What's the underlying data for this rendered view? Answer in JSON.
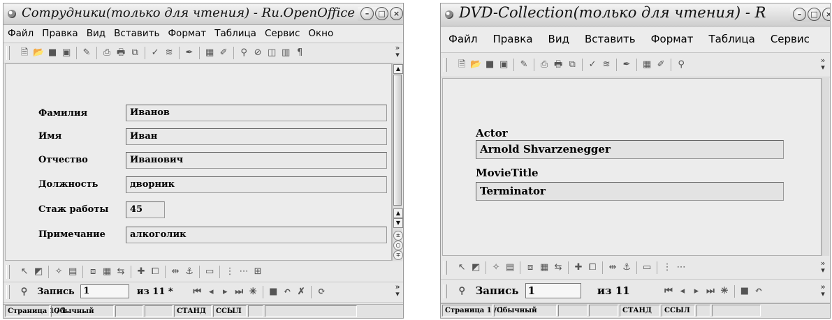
{
  "left_window": {
    "title": "Сотрудники(только для чтения) - Ru.OpenOffice",
    "menu": [
      "Файл",
      "Правка",
      "Вид",
      "Вставить",
      "Формат",
      "Таблица",
      "Сервис",
      "Окно"
    ],
    "fields": [
      {
        "label": "Фамилия",
        "value": "Иванов"
      },
      {
        "label": "Имя",
        "value": "Иван"
      },
      {
        "label": "Отчество",
        "value": "Иванович"
      },
      {
        "label": "Должность",
        "value": "дворник"
      },
      {
        "label": "Стаж работы",
        "value": "45"
      },
      {
        "label": "Примечание",
        "value": "алкоголик"
      }
    ],
    "nav": {
      "record_label": "Запись",
      "record_value": "1",
      "of_text": "из 11 *"
    },
    "status": {
      "page": "Страница 1 / 1",
      "style": "Обычный",
      "mode": "СТАНД",
      "ref": "ССЫЛ"
    }
  },
  "right_window": {
    "title": "DVD-Collection(только для чтения) - R",
    "menu": [
      "Файл",
      "Правка",
      "Вид",
      "Вставить",
      "Формат",
      "Таблица",
      "Сервис"
    ],
    "fields": [
      {
        "label": "Actor",
        "value": "Arnold Shvarzenegger"
      },
      {
        "label": "MovieTitle",
        "value": "Terminator"
      }
    ],
    "nav": {
      "record_label": "Запись",
      "record_value": "1",
      "of_text": "из 11"
    },
    "status": {
      "page": "Страница 1 / 1",
      "style": "Обычный",
      "mode": "СТАНД",
      "ref": "ССЫЛ"
    }
  },
  "icons": {
    "standard_toolbar": [
      "new-icon",
      "open-icon",
      "save-icon",
      "save-as-icon",
      "edit-icon",
      "export-pdf-icon",
      "print-icon",
      "preview-icon",
      "spellcheck-icon",
      "autospell-icon",
      "brush-icon",
      "table-icon",
      "draw-icon",
      "find-icon",
      "navigator-icon",
      "gallery-icon",
      "datasource-icon",
      "pilcrow-icon"
    ],
    "form_toolbar": [
      "select-icon",
      "design-mode-icon",
      "control-wizard-icon",
      "form-properties-icon",
      "form-navigator-icon",
      "table-control-icon",
      "tab-order-icon",
      "add-field-icon",
      "open-design-icon",
      "position-size-icon",
      "anchor-icon",
      "align-icon",
      "grid-icon",
      "snap-icon",
      "guides-icon"
    ],
    "nav_toolbar": [
      "find-record-icon",
      "first-record-icon",
      "prev-record-icon",
      "next-record-icon",
      "last-record-icon",
      "new-record-icon",
      "save-record-icon",
      "undo-record-icon",
      "delete-record-icon",
      "refresh-icon"
    ]
  }
}
